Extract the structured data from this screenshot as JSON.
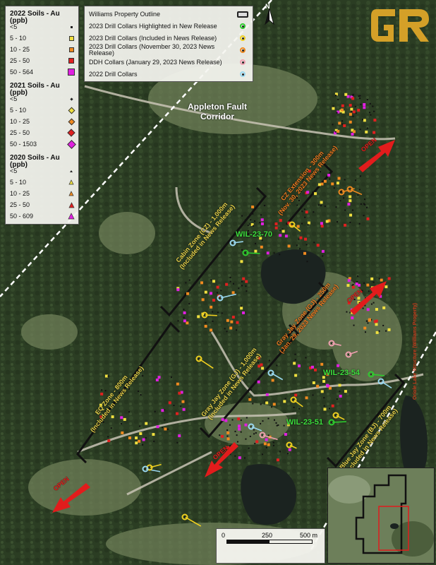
{
  "soil_legend": {
    "groups": [
      {
        "title": "2022 Soils - Au (ppb)",
        "shape": "square",
        "items": [
          {
            "label": "<5",
            "color": "#222222"
          },
          {
            "label": "5 - 10",
            "color": "#f0e040"
          },
          {
            "label": "10 - 25",
            "color": "#f08a20"
          },
          {
            "label": "25 - 50",
            "color": "#e02020"
          },
          {
            "label": "50 - 564",
            "color": "#e020e0"
          }
        ]
      },
      {
        "title": "2021 Soils - Au (ppb)",
        "shape": "diamond",
        "items": [
          {
            "label": "<5",
            "color": "#222222"
          },
          {
            "label": "5 - 10",
            "color": "#f0e040"
          },
          {
            "label": "10 - 25",
            "color": "#f08a20"
          },
          {
            "label": "25 - 50",
            "color": "#e02020"
          },
          {
            "label": "50 - 1503",
            "color": "#e020e0"
          }
        ]
      },
      {
        "title": "2020 Soils - Au (ppb)",
        "shape": "triangle",
        "items": [
          {
            "label": "<5",
            "color": "#222222"
          },
          {
            "label": "5 - 10",
            "color": "#f0e040"
          },
          {
            "label": "10 - 25",
            "color": "#f08a20"
          },
          {
            "label": "25 - 50",
            "color": "#e02020"
          },
          {
            "label": "50 - 609",
            "color": "#e020e0"
          }
        ]
      }
    ]
  },
  "collar_legend": {
    "items": [
      {
        "label": "Williams Property Outline",
        "symbol": "outline-box",
        "color": "#222222"
      },
      {
        "label": "2023 Drill Collars Highlighted in New Release",
        "symbol": "ring",
        "color": "#2ecc2e"
      },
      {
        "label": "2023 Drill Collars (Included in News Release)",
        "symbol": "ring",
        "color": "#f0d020"
      },
      {
        "label": "2023 Drill Collars (November 30, 2023 News Release)",
        "symbol": "ring",
        "color": "#f08a20"
      },
      {
        "label": "DDH Collars (January 29, 2023 News Release)",
        "symbol": "ring",
        "color": "#f0a0b0"
      },
      {
        "label": "2022 Drill Collars",
        "symbol": "ring",
        "color": "#9ad8f0"
      }
    ]
  },
  "map_labels": {
    "fault_line1": "Appleton Fault",
    "fault_line2": "Corridor",
    "cz_ext_line1": "CZ Extension - 300m",
    "cz_ext_line2": "(Nov. 30, 2023 News Release)",
    "cz_line1": "Cabin Zone (CZ) - 1,000m",
    "cz_line2": "(Included in News Release)",
    "gjz_line1": "Gray Jay Zone (GJ) - 250m",
    "gjz_line2": "(Jan. 29, 2023 News Release)",
    "eq_line1": "EQ Zone - 800m",
    "eq_line2": "(Included in News Release)",
    "gjz2_line1": "Gray Jay Zone (GJ) - 1,000m",
    "gjz2_line2": "(Included in News Release)",
    "bjz_line1": "Blue Jay Zone (BJ) - 700m",
    "bjz_line2": "(Included in News Release)",
    "hole1": "WIL-23-70",
    "hole2": "WIL-23-54",
    "hole3": "WIL-23-51",
    "open1": "OPEN",
    "open2": "OPEN",
    "open3": "OPEN",
    "open4": "OPEN",
    "edge_text": "Oriole Lake Structure (Williams Property)"
  },
  "north": {
    "label": "N"
  },
  "scale": {
    "ticks": [
      "0",
      "250",
      "500 m"
    ]
  },
  "logo": {
    "text": "GR"
  },
  "colors": {
    "forest": "#2c3f24",
    "clearing": "#6f7f58",
    "road": "#c9c4b5",
    "lake": "#1b2320",
    "zone_yellow": "#e8d24a",
    "zone_orange": "#f07a20",
    "hole_green": "#3dde3d",
    "arrow_red": "#e21c1c",
    "logo_gold": "#d4a028"
  }
}
